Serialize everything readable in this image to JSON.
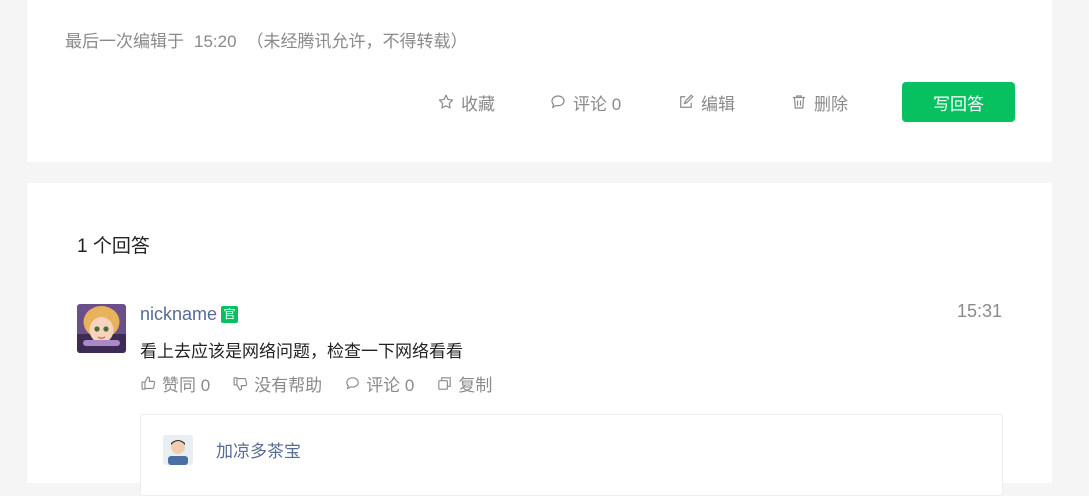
{
  "question_footer": {
    "edited_label": "最后一次编辑于",
    "edited_time": "15:20",
    "copyright_note": "（未经腾讯允许，不得转载）",
    "actions": {
      "favorite": "收藏",
      "comment": "评论 0",
      "edit": "编辑",
      "delete": "删除",
      "write_answer": "写回答"
    }
  },
  "answers": {
    "count_label": "1 个回答",
    "items": [
      {
        "nickname": "nickname",
        "badge": "官",
        "time": "15:31",
        "text": "看上去应该是网络问题，检查一下网络看看",
        "actions": {
          "like": "赞同 0",
          "unhelpful": "没有帮助",
          "comment": "评论 0",
          "copy": "复制"
        },
        "reply": {
          "nickname": "加凉多茶宝"
        }
      }
    ]
  },
  "colors": {
    "accent": "#07c160",
    "link": "#576b95",
    "muted": "#8a8a8a"
  }
}
